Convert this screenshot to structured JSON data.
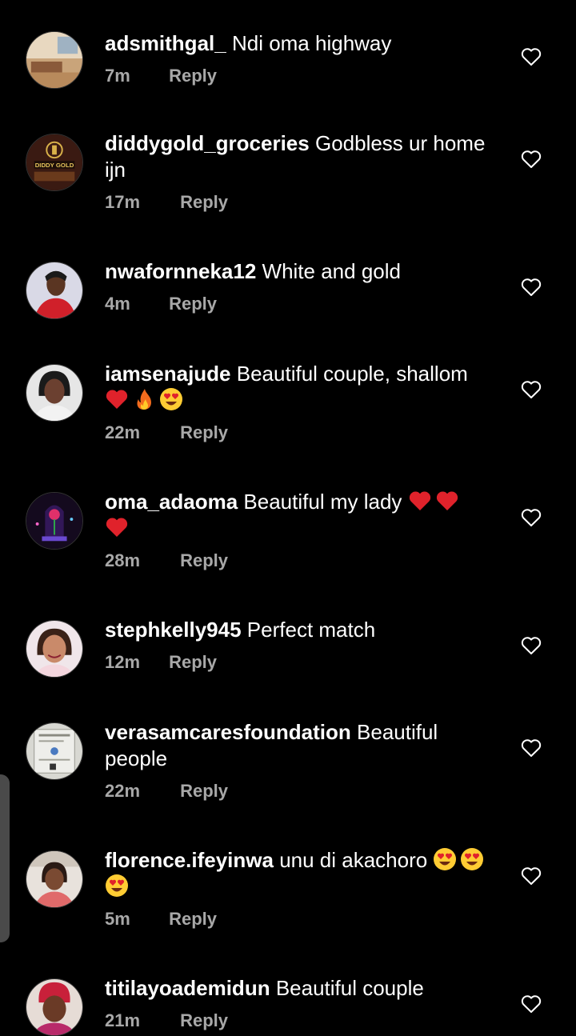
{
  "comments": [
    {
      "username": "adsmithgal_",
      "text": "Ndi oma highway",
      "time": "7m",
      "reply": "Reply",
      "avatar": "avatar-room-icon",
      "like": "heart-outline-icon"
    },
    {
      "username": "diddygold_groceries",
      "text": "Godbless ur home ijn",
      "time": "17m",
      "reply": "Reply",
      "avatar": "avatar-diddy-gold-logo",
      "avatar_text": "DIDDY GOLD",
      "like": "heart-outline-icon"
    },
    {
      "username": "nwafornneka12",
      "text": "White and gold",
      "time": "4m",
      "reply": "Reply",
      "avatar": "avatar-woman-red-top",
      "like": "heart-outline-icon"
    },
    {
      "username": "iamsenajude",
      "text": "Beautiful couple, shallom",
      "emojis": [
        "heart-emoji",
        "fire-emoji",
        "heart-eyes-emoji"
      ],
      "time": "22m",
      "reply": "Reply",
      "avatar": "avatar-woman-portrait",
      "like": "heart-outline-icon"
    },
    {
      "username": "oma_adaoma",
      "text": "Beautiful my lady",
      "emojis": [
        "heart-emoji",
        "heart-emoji",
        "heart-emoji"
      ],
      "time": "28m",
      "reply": "Reply",
      "avatar": "avatar-rose-dome",
      "like": "heart-outline-icon"
    },
    {
      "username": "stephkelly945",
      "text": "Perfect match",
      "time": "12m",
      "reply": "Reply",
      "avatar": "avatar-woman-smiling",
      "like": "heart-outline-icon"
    },
    {
      "username": "verasamcaresfoundation",
      "text": "Beautiful people",
      "time": "22m",
      "reply": "Reply",
      "avatar": "avatar-certificate",
      "like": "heart-outline-icon"
    },
    {
      "username": "florence.ifeyinwa",
      "text": "unu di akachoro",
      "emojis": [
        "heart-eyes-emoji",
        "heart-eyes-emoji",
        "heart-eyes-emoji"
      ],
      "time": "5m",
      "reply": "Reply",
      "avatar": "avatar-woman-car",
      "like": "heart-outline-icon"
    },
    {
      "username": "titilayoademidun",
      "text": "Beautiful couple",
      "time": "21m",
      "reply": "Reply",
      "avatar": "avatar-woman-headwrap",
      "like": "heart-outline-icon"
    }
  ],
  "colors": {
    "background": "#000000",
    "primary_text": "#ffffff",
    "secondary_text": "#a8a8a8",
    "emoji_heart": "#e0222b"
  }
}
